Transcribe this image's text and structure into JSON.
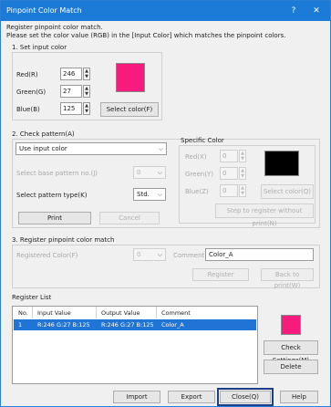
{
  "window": {
    "title": "Pinpoint Color Match",
    "help_glyph": "?",
    "close_glyph": "✕"
  },
  "description": {
    "line1": "Register pinpoint color match.",
    "line2": "Please set the color value (RGB) in the [Input Color] which matches the pinpoint colors."
  },
  "input_color": {
    "section_label": "1. Set input color",
    "red_label": "Red(R)",
    "red_value": "246",
    "green_label": "Green(G)",
    "green_value": "27",
    "blue_label": "Blue(B)",
    "blue_value": "125",
    "select_button": "Select color(F)",
    "swatch_color": "#f61b7d"
  },
  "check_pattern": {
    "section_label": "2. Check pattern(A)",
    "pattern_dropdown_value": "Use input color",
    "base_pattern_label": "Select base pattern no.(J)",
    "base_pattern_value": "0",
    "pattern_type_label": "Select pattern type(K)",
    "pattern_type_value": "Std.",
    "print_button": "Print",
    "cancel_button": "Cancel"
  },
  "specific_color": {
    "label": "Specific Color",
    "red_label": "Red(X)",
    "red_value": "0",
    "green_label": "Green(Y)",
    "green_value": "0",
    "blue_label": "Blue(Z)",
    "blue_value": "0",
    "select_button": "Select color(Q)",
    "step_button": "Step to register without print(N)",
    "swatch_color": "#000000"
  },
  "register_match": {
    "section_label": "3. Register pinpoint color match",
    "registered_color_label": "Registered Color(F)",
    "registered_color_value": "0",
    "comment_label": "Comment",
    "comment_value": "Color_A",
    "register_button": "Register",
    "back_button": "Back to print(W)"
  },
  "register_list": {
    "label": "Register List",
    "columns": [
      "No.",
      "Input Value",
      "Output Value",
      "Comment"
    ],
    "rows": [
      {
        "no": "1",
        "input": "R:246 G:27 B:125",
        "output": "R:246 G:27 B:125",
        "comment": "Color_A"
      }
    ],
    "swatch_color": "#f61b7d",
    "check_settings_button": "Check Settings(M)",
    "delete_button": "Delete"
  },
  "footer": {
    "import_button": "Import",
    "export_button": "Export",
    "close_button": "Close(Q)",
    "help_button": "Help"
  }
}
